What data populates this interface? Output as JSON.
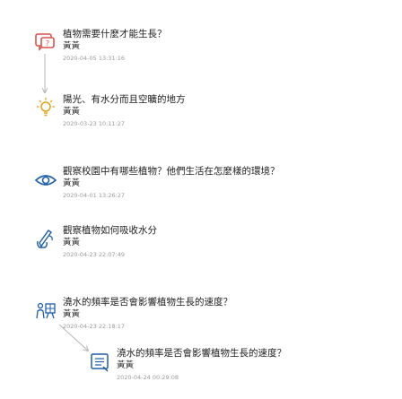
{
  "colors": {
    "connector": "#b5b5b5",
    "icon_question": "#d9534f",
    "icon_idea": "#e0a21b",
    "icon_observe": "#1f5fa8",
    "icon_experiment": "#1f5fa8"
  },
  "nodes": [
    {
      "title": "植物需要什麼才能生長？",
      "author": "黃黃",
      "timestamp": "2020-04-05 13:31:16",
      "icon": "question-icon"
    },
    {
      "title": "陽光、有水分而且空曠的地方",
      "author": "黃黃",
      "timestamp": "2020-03-23 10:11:27",
      "icon": "lightbulb-icon"
    },
    {
      "title": "觀察校園中有哪些植物？他們生活在怎麼樣的環境？",
      "author": "黃黃",
      "timestamp": "2020-04-01 13:26:27",
      "icon": "eye-icon"
    },
    {
      "title": "觀察植物如何吸收水分",
      "author": "黃黃",
      "timestamp": "2020-04-23 22:07:49",
      "icon": "pencil-hand-icon"
    },
    {
      "title": "澆水的頻率是否會影響植物生長的速度？",
      "author": "黃黃",
      "timestamp": "2020-04-23 22:18:17",
      "icon": "experiment-icon"
    },
    {
      "title": "澆水的頻率是否會影響植物生長的速度？",
      "author": "黃黃",
      "timestamp": "2020-04-24 00:29:08",
      "icon": "question-answer-icon"
    }
  ]
}
